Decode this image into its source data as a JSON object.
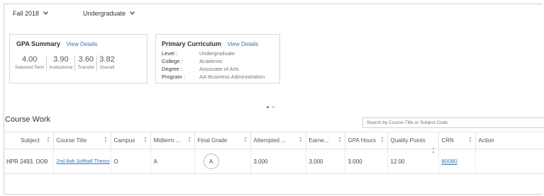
{
  "filters": {
    "term": "Fall 2018",
    "level": "Undergraduate"
  },
  "gpa_summary": {
    "title": "GPA Summary",
    "view_details": "View Details",
    "stats": [
      {
        "value": "4.00",
        "label": "Selected Term"
      },
      {
        "value": "3.90",
        "label": "Institutional"
      },
      {
        "value": "3.60",
        "label": "Transfer"
      },
      {
        "value": "3.82",
        "label": "Overall"
      }
    ]
  },
  "curriculum": {
    "title": "Primary Curriculum",
    "view_details": "View Details",
    "rows": [
      {
        "key": "Level :",
        "value": "Undergraduate"
      },
      {
        "key": "College :",
        "value": "Academic"
      },
      {
        "key": "Degree :",
        "value": "Associate of Arts"
      },
      {
        "key": "Program :",
        "value": "AA-Business Administration"
      }
    ]
  },
  "course_work": {
    "title": "Course Work",
    "search_placeholder": "Search by Course Title or Subject Code",
    "columns": [
      "Subject",
      "Course Title",
      "Campus",
      "Midterm ...",
      "Final Grade",
      "Attempted ...",
      "Earne...",
      "GPA Hours",
      "Quality Points",
      "CRN",
      "Action"
    ],
    "rows": [
      {
        "subject": "HPR 2493, OO9",
        "course_title": "2nd 8wk Softball Theory",
        "campus": "O",
        "midterm": "A",
        "final_grade": "A",
        "attempted": "3.000",
        "earned": "3.000",
        "gpa_hours": "3.000",
        "quality_points": "12.00",
        "crn": "80080",
        "action": ""
      }
    ]
  },
  "colors": {
    "link": "#3b73b9",
    "border": "#d9d9d9"
  }
}
